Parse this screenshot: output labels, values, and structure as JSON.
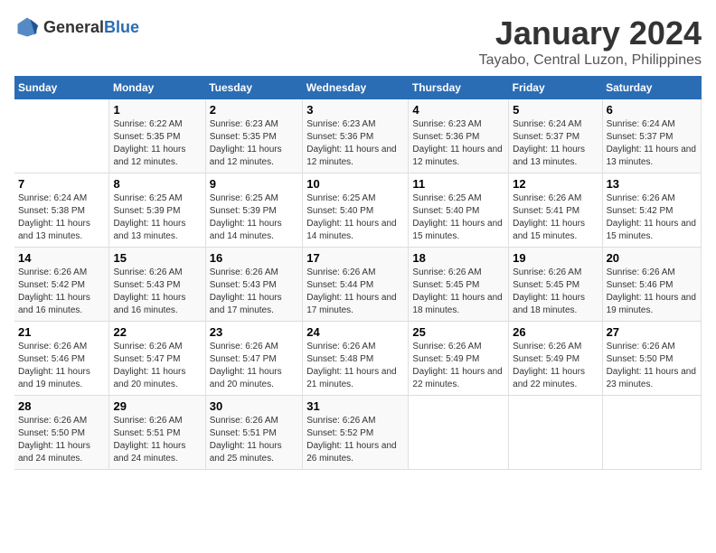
{
  "header": {
    "logo_general": "General",
    "logo_blue": "Blue",
    "title": "January 2024",
    "subtitle": "Tayabo, Central Luzon, Philippines"
  },
  "days_of_week": [
    "Sunday",
    "Monday",
    "Tuesday",
    "Wednesday",
    "Thursday",
    "Friday",
    "Saturday"
  ],
  "weeks": [
    [
      {
        "day": "",
        "sunrise": "",
        "sunset": "",
        "daylight": ""
      },
      {
        "day": "1",
        "sunrise": "Sunrise: 6:22 AM",
        "sunset": "Sunset: 5:35 PM",
        "daylight": "Daylight: 11 hours and 12 minutes."
      },
      {
        "day": "2",
        "sunrise": "Sunrise: 6:23 AM",
        "sunset": "Sunset: 5:35 PM",
        "daylight": "Daylight: 11 hours and 12 minutes."
      },
      {
        "day": "3",
        "sunrise": "Sunrise: 6:23 AM",
        "sunset": "Sunset: 5:36 PM",
        "daylight": "Daylight: 11 hours and 12 minutes."
      },
      {
        "day": "4",
        "sunrise": "Sunrise: 6:23 AM",
        "sunset": "Sunset: 5:36 PM",
        "daylight": "Daylight: 11 hours and 12 minutes."
      },
      {
        "day": "5",
        "sunrise": "Sunrise: 6:24 AM",
        "sunset": "Sunset: 5:37 PM",
        "daylight": "Daylight: 11 hours and 13 minutes."
      },
      {
        "day": "6",
        "sunrise": "Sunrise: 6:24 AM",
        "sunset": "Sunset: 5:37 PM",
        "daylight": "Daylight: 11 hours and 13 minutes."
      }
    ],
    [
      {
        "day": "7",
        "sunrise": "Sunrise: 6:24 AM",
        "sunset": "Sunset: 5:38 PM",
        "daylight": "Daylight: 11 hours and 13 minutes."
      },
      {
        "day": "8",
        "sunrise": "Sunrise: 6:25 AM",
        "sunset": "Sunset: 5:39 PM",
        "daylight": "Daylight: 11 hours and 13 minutes."
      },
      {
        "day": "9",
        "sunrise": "Sunrise: 6:25 AM",
        "sunset": "Sunset: 5:39 PM",
        "daylight": "Daylight: 11 hours and 14 minutes."
      },
      {
        "day": "10",
        "sunrise": "Sunrise: 6:25 AM",
        "sunset": "Sunset: 5:40 PM",
        "daylight": "Daylight: 11 hours and 14 minutes."
      },
      {
        "day": "11",
        "sunrise": "Sunrise: 6:25 AM",
        "sunset": "Sunset: 5:40 PM",
        "daylight": "Daylight: 11 hours and 15 minutes."
      },
      {
        "day": "12",
        "sunrise": "Sunrise: 6:26 AM",
        "sunset": "Sunset: 5:41 PM",
        "daylight": "Daylight: 11 hours and 15 minutes."
      },
      {
        "day": "13",
        "sunrise": "Sunrise: 6:26 AM",
        "sunset": "Sunset: 5:42 PM",
        "daylight": "Daylight: 11 hours and 15 minutes."
      }
    ],
    [
      {
        "day": "14",
        "sunrise": "Sunrise: 6:26 AM",
        "sunset": "Sunset: 5:42 PM",
        "daylight": "Daylight: 11 hours and 16 minutes."
      },
      {
        "day": "15",
        "sunrise": "Sunrise: 6:26 AM",
        "sunset": "Sunset: 5:43 PM",
        "daylight": "Daylight: 11 hours and 16 minutes."
      },
      {
        "day": "16",
        "sunrise": "Sunrise: 6:26 AM",
        "sunset": "Sunset: 5:43 PM",
        "daylight": "Daylight: 11 hours and 17 minutes."
      },
      {
        "day": "17",
        "sunrise": "Sunrise: 6:26 AM",
        "sunset": "Sunset: 5:44 PM",
        "daylight": "Daylight: 11 hours and 17 minutes."
      },
      {
        "day": "18",
        "sunrise": "Sunrise: 6:26 AM",
        "sunset": "Sunset: 5:45 PM",
        "daylight": "Daylight: 11 hours and 18 minutes."
      },
      {
        "day": "19",
        "sunrise": "Sunrise: 6:26 AM",
        "sunset": "Sunset: 5:45 PM",
        "daylight": "Daylight: 11 hours and 18 minutes."
      },
      {
        "day": "20",
        "sunrise": "Sunrise: 6:26 AM",
        "sunset": "Sunset: 5:46 PM",
        "daylight": "Daylight: 11 hours and 19 minutes."
      }
    ],
    [
      {
        "day": "21",
        "sunrise": "Sunrise: 6:26 AM",
        "sunset": "Sunset: 5:46 PM",
        "daylight": "Daylight: 11 hours and 19 minutes."
      },
      {
        "day": "22",
        "sunrise": "Sunrise: 6:26 AM",
        "sunset": "Sunset: 5:47 PM",
        "daylight": "Daylight: 11 hours and 20 minutes."
      },
      {
        "day": "23",
        "sunrise": "Sunrise: 6:26 AM",
        "sunset": "Sunset: 5:47 PM",
        "daylight": "Daylight: 11 hours and 20 minutes."
      },
      {
        "day": "24",
        "sunrise": "Sunrise: 6:26 AM",
        "sunset": "Sunset: 5:48 PM",
        "daylight": "Daylight: 11 hours and 21 minutes."
      },
      {
        "day": "25",
        "sunrise": "Sunrise: 6:26 AM",
        "sunset": "Sunset: 5:49 PM",
        "daylight": "Daylight: 11 hours and 22 minutes."
      },
      {
        "day": "26",
        "sunrise": "Sunrise: 6:26 AM",
        "sunset": "Sunset: 5:49 PM",
        "daylight": "Daylight: 11 hours and 22 minutes."
      },
      {
        "day": "27",
        "sunrise": "Sunrise: 6:26 AM",
        "sunset": "Sunset: 5:50 PM",
        "daylight": "Daylight: 11 hours and 23 minutes."
      }
    ],
    [
      {
        "day": "28",
        "sunrise": "Sunrise: 6:26 AM",
        "sunset": "Sunset: 5:50 PM",
        "daylight": "Daylight: 11 hours and 24 minutes."
      },
      {
        "day": "29",
        "sunrise": "Sunrise: 6:26 AM",
        "sunset": "Sunset: 5:51 PM",
        "daylight": "Daylight: 11 hours and 24 minutes."
      },
      {
        "day": "30",
        "sunrise": "Sunrise: 6:26 AM",
        "sunset": "Sunset: 5:51 PM",
        "daylight": "Daylight: 11 hours and 25 minutes."
      },
      {
        "day": "31",
        "sunrise": "Sunrise: 6:26 AM",
        "sunset": "Sunset: 5:52 PM",
        "daylight": "Daylight: 11 hours and 26 minutes."
      },
      {
        "day": "",
        "sunrise": "",
        "sunset": "",
        "daylight": ""
      },
      {
        "day": "",
        "sunrise": "",
        "sunset": "",
        "daylight": ""
      },
      {
        "day": "",
        "sunrise": "",
        "sunset": "",
        "daylight": ""
      }
    ]
  ]
}
